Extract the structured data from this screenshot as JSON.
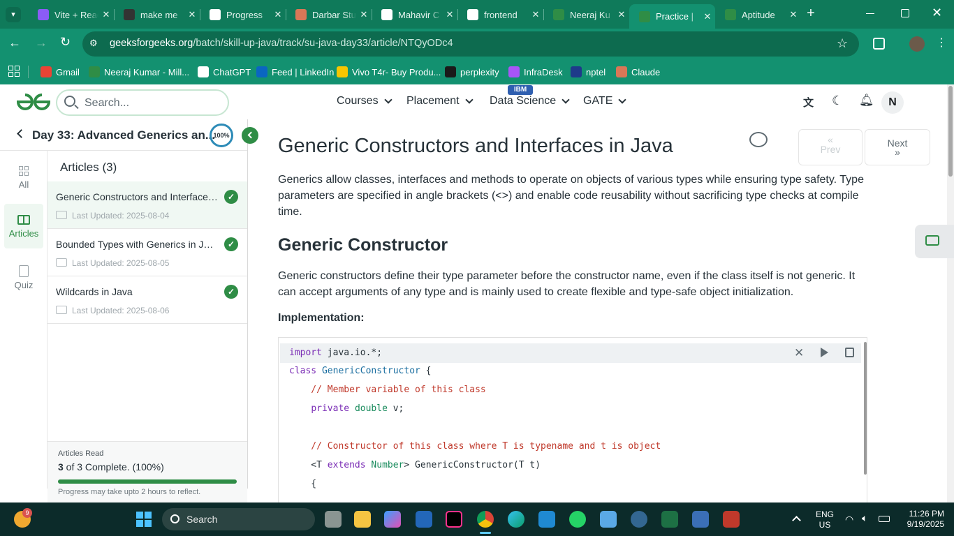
{
  "browser": {
    "tabs": [
      {
        "label": "Vite + React",
        "icon": "vite-icon",
        "color": "#8b5cf6"
      },
      {
        "label": "make me",
        "icon": "app-icon",
        "color": "#333333"
      },
      {
        "label": "Progress",
        "icon": "chatgpt-icon",
        "color": "#ffffff"
      },
      {
        "label": "Darbar Studio",
        "icon": "claude-icon",
        "color": "#d97757"
      },
      {
        "label": "Mahavir C",
        "icon": "doc-icon",
        "color": "#ffffff"
      },
      {
        "label": "frontend",
        "icon": "github-icon",
        "color": "#ffffff"
      },
      {
        "label": "Neeraj Ku",
        "icon": "gfg-icon",
        "color": "#2f8d46"
      },
      {
        "label": "Practice |",
        "icon": "gfg-icon",
        "color": "#2f8d46"
      },
      {
        "label": "Aptitude",
        "icon": "gfg-icon",
        "color": "#2f8d46"
      }
    ],
    "url_domain": "geeksforgeeks.org",
    "url_path": "/batch/skill-up-java/track/su-java-day33/article/NTQyODc4",
    "bookmarks": [
      {
        "label": "Gmail",
        "icon": "gmail-icon"
      },
      {
        "label": "Neeraj Kumar - Mill...",
        "icon": "gfg-icon"
      },
      {
        "label": "ChatGPT",
        "icon": "chatgpt-icon"
      },
      {
        "label": "Feed | LinkedIn",
        "icon": "linkedin-icon"
      },
      {
        "label": "Vivo T4r- Buy Produ...",
        "icon": "flipkart-icon"
      },
      {
        "label": "perplexity",
        "icon": "perplexity-icon"
      },
      {
        "label": "InfraDesk",
        "icon": "infradesk-icon"
      },
      {
        "label": "nptel",
        "icon": "nptel-icon"
      },
      {
        "label": "Claude",
        "icon": "claude-icon"
      }
    ]
  },
  "site": {
    "search_placeholder": "Search...",
    "nav": [
      {
        "label": "Courses"
      },
      {
        "label": "Placement"
      },
      {
        "label": "Data Science",
        "badge": "IBM"
      },
      {
        "label": "GATE"
      }
    ],
    "avatar_letter": "N"
  },
  "sidebar": {
    "day_title": "Day 33: Advanced Generics an...",
    "progress_label": "100%",
    "rail": [
      {
        "label": "All"
      },
      {
        "label": "Articles"
      },
      {
        "label": "Quiz"
      }
    ],
    "articles_heading": "Articles (3)",
    "articles": [
      {
        "title": "Generic Constructors and Interfaces in Java",
        "date": "Last Updated: 2025-08-04"
      },
      {
        "title": "Bounded Types with Generics in Java",
        "date": "Last Updated: 2025-08-05"
      },
      {
        "title": "Wildcards in Java",
        "date": "Last Updated: 2025-08-06"
      }
    ],
    "footer": {
      "label": "Articles Read",
      "count_bold": "3",
      "count_rest": " of 3 Complete. (100%)",
      "progress": 1.0,
      "note": "Progress may take upto 2 hours to reflect."
    }
  },
  "article": {
    "title": "Generic Constructors and Interfaces in Java",
    "intro": "Generics allow classes, interfaces and methods to operate on objects of various types while ensuring type safety. Type parameters are specified in angle brackets (<>) and enable code reusability without sacrificing type checks at compile time.",
    "h2": "Generic Constructor",
    "p2": "Generic constructors define their type parameter before the constructor name, even if the class itself is not generic. It can accept arguments of any type and is mainly used to create flexible and type-safe object initialization.",
    "impl_label": "Implementation:",
    "prev_label": "Prev",
    "next_label": "Next",
    "code": [
      "import java.io.*;",
      "class GenericConstructor {",
      "    // Member variable of this class",
      "    private double v;",
      "",
      "    // Constructor of this class where T is typename and t is object",
      "    <T extends Number> GenericConstructor(T t)",
      "    {"
    ]
  },
  "taskbar": {
    "search_label": "Search",
    "weather_badge": "9",
    "lang_line1": "ENG",
    "lang_line2": "US",
    "time": "11:26 PM",
    "date": "9/19/2025"
  }
}
